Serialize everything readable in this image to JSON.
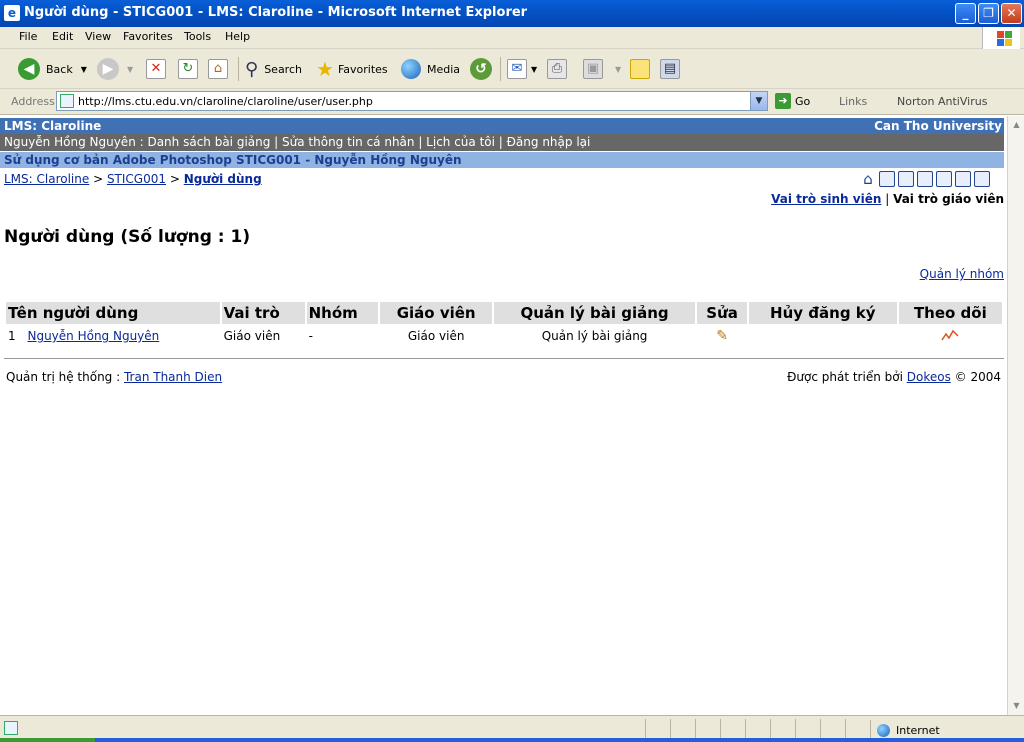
{
  "window": {
    "title": "Người dùng - STICG001 - LMS: Claroline - Microsoft Internet Explorer",
    "min": "_",
    "max": "❐",
    "close": "✕"
  },
  "menu": [
    "File",
    "Edit",
    "View",
    "Favorites",
    "Tools",
    "Help"
  ],
  "toolbar": {
    "back": "Back",
    "search": "Search",
    "favorites": "Favorites",
    "media": "Media"
  },
  "address": {
    "label": "Address",
    "url": "http://lms.ctu.edu.vn/claroline/claroline/user/user.php",
    "go": "Go",
    "links": "Links",
    "norton": "Norton AntiVirus"
  },
  "page": {
    "site_name": "LMS: Claroline",
    "institution": "Can Tho University",
    "user_bar": "Nguyễn Hồng Nguyên : Danh sách bài giảng | Sửa thông tin cá nhân | Lịch của tôi | Đăng nhập lại",
    "course_title": "Sử dụng cơ bản Adobe Photoshop STICG001 - Nguyễn Hồng Nguyên",
    "breadcrumb": {
      "home": "LMS: Claroline",
      "sep1": " > ",
      "course": "STICG001",
      "sep2": " > ",
      "current": "Người dùng"
    },
    "roles": {
      "student": "Vai trò sinh viên",
      "sep": " | ",
      "teacher": "Vai trò giáo viên"
    },
    "heading": "Người dùng (Số lượng : 1)",
    "manage_groups": "Quản lý nhóm",
    "table": {
      "headers": [
        "Tên người dùng",
        "Vai trò",
        "Nhóm",
        "Giáo viên",
        "Quản lý bài giảng",
        "Sửa",
        "Hủy đăng ký",
        "Theo dõi"
      ],
      "rows": [
        {
          "index": "1",
          "name": "Nguyễn Hồng Nguyên",
          "role": "Giáo viên",
          "group": "-",
          "teacher": "Giáo viên",
          "course_admin": "Quản lý bài giảng",
          "edit_icon": "pencil-icon",
          "unregister": "",
          "tracking_icon": "stats-icon"
        }
      ]
    },
    "footer": {
      "admin_label": "Quản trị hệ thống : ",
      "admin_name": "Tran Thanh Dien",
      "powered_label": "Được phát triển bởi ",
      "powered_name": "Dokeos",
      "copyright": " © 2004"
    }
  },
  "status": {
    "zone": "Internet"
  },
  "colors": {
    "top_bar": "#4171b5",
    "user_bar": "#676767",
    "course_bar": "#8fb3e3",
    "link": "#0a2a9a",
    "header_cell": "#dfdfdf"
  }
}
